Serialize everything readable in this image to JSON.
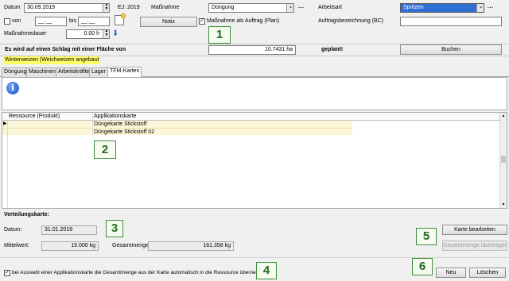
{
  "top": {
    "datum_label": "Datum",
    "datum_value": "30.09.2019",
    "ej_label": "EJ: 2019",
    "massnahme_label": "Maßnahme",
    "massnahme_value": "Düngung",
    "ellipsis": "...",
    "arbeitsart_label": "Arbeitsart",
    "arbeitsart_value": "Spritzen",
    "von_label": "von",
    "von_value": "__.__",
    "bis_label": "bis",
    "bis_value": "__.__",
    "notiz_label": "Notiz",
    "als_auftrag_label": "Maßnahme als Auftrag (Plan)",
    "auftragsbezeichnung_label": "Auftragsbezeichnung (BC)",
    "auftragsbezeichnung_value": "",
    "dauer_label": "Maßnahmedauer",
    "dauer_value": "0.00 h"
  },
  "area_bar": {
    "text": "Es wird auf einen Schlag mit einer Fläche von",
    "area_value": "10.7431 ha",
    "status": "geplant!",
    "buchen_label": "Buchen"
  },
  "crop": {
    "label": "Winterweizen (Weichweizen angebaut"
  },
  "tabs": [
    {
      "label": "Düngung"
    },
    {
      "label": "Maschinen"
    },
    {
      "label": "Arbeitskräfte"
    },
    {
      "label": "Lager"
    },
    {
      "label": "TFM-Karten"
    }
  ],
  "info": {
    "icon_glyph": "i"
  },
  "table": {
    "headers": [
      "Ressource (Produkt)",
      "Applikationskarte"
    ],
    "rows": [
      {
        "resource": "",
        "map": "Düngekarte Stickstoff"
      },
      {
        "resource": "",
        "map": "Düngekarte Stickstoff 02"
      }
    ]
  },
  "verteilung": {
    "title": "Verteilungskarte:",
    "datum_label": "Datum:",
    "datum_value": "31.01.2019",
    "mittelwert_label": "Mittelwert:",
    "mittelwert_value": "15.000 kg",
    "gesamtmenge_label": "Gesamtmenge:",
    "gesamtmenge_value": "161.358 kg",
    "karte_bearbeiten_label": "Karte bearbeiten",
    "gesamtmenge_uebertragen_label": "Gesamtmenge übertragen",
    "auto_checkbox_label": "bei Auswahl einer Applikationskarte die Gesamtmenge aus der Karte automatisch in die Ressource übernehmen",
    "neu_label": "Neu",
    "loeschen_label": "Löschen"
  },
  "callouts": [
    "1",
    "2",
    "3",
    "4",
    "5",
    "6"
  ],
  "colors": {
    "callout_border": "#3c8d3c",
    "selected_blue": "#2f6fd6",
    "crop_highlight": "#ffff66",
    "row_highlight": "#fcf6d8"
  }
}
